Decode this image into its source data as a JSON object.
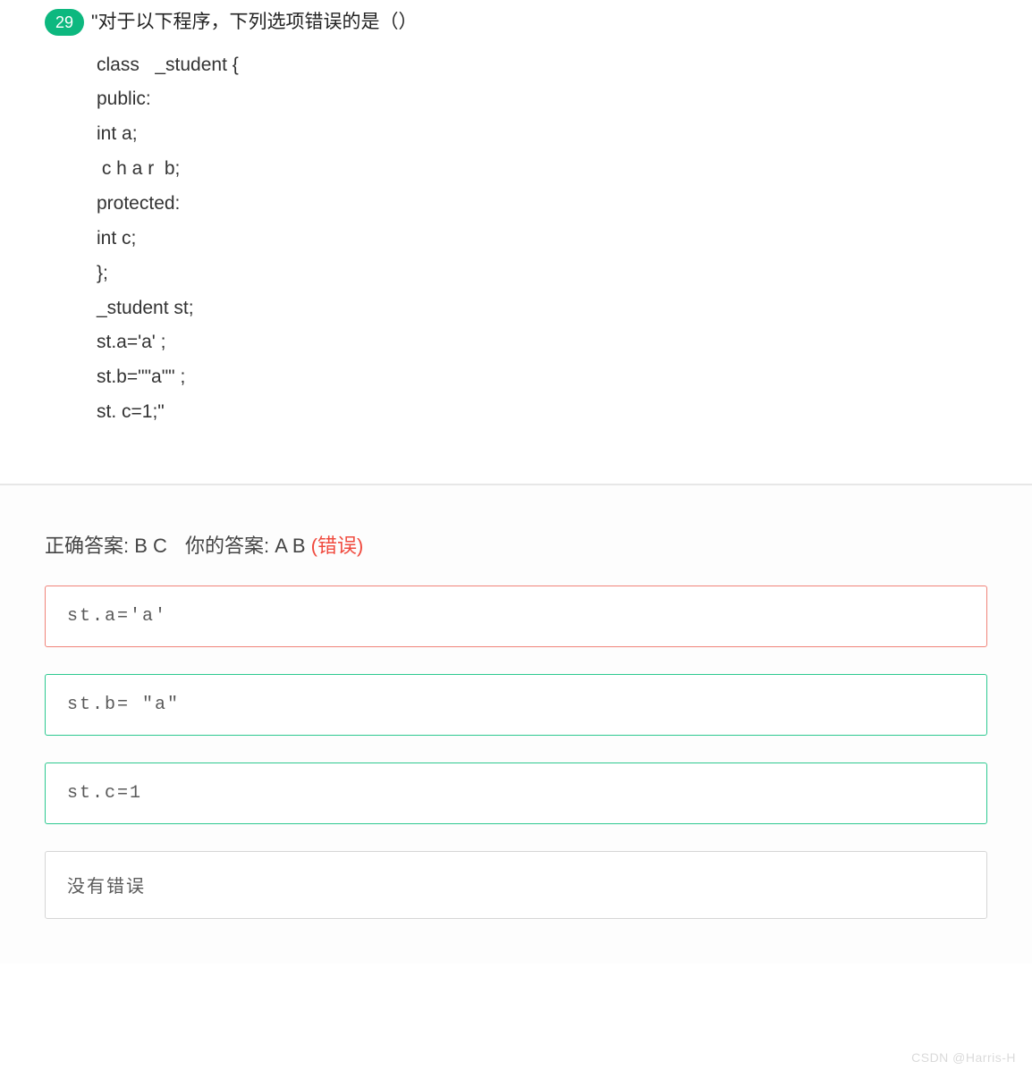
{
  "question": {
    "number": "29",
    "title": "\"对于以下程序，下列选项错误的是（）",
    "code_lines": [
      "class   _student {",
      "public:",
      "int a;",
      " c h a r  b;",
      "protected:",
      "int c;",
      "};",
      "_student st;",
      "st.a='a' ;",
      "st.b=\"\"a\"\" ;",
      "st. c=1;\""
    ]
  },
  "answers": {
    "correct_label": "正确答案: ",
    "correct_value": "B C",
    "your_label": "你的答案: ",
    "your_value": "A B ",
    "status": "(错误)"
  },
  "options": [
    {
      "text": "st.a='a'",
      "style": "red"
    },
    {
      "text": "st.b= \"a\"",
      "style": "green"
    },
    {
      "text": "st.c=1",
      "style": "green"
    },
    {
      "text": "没有错误",
      "style": "gray"
    }
  ],
  "watermark": "CSDN @Harris-H"
}
